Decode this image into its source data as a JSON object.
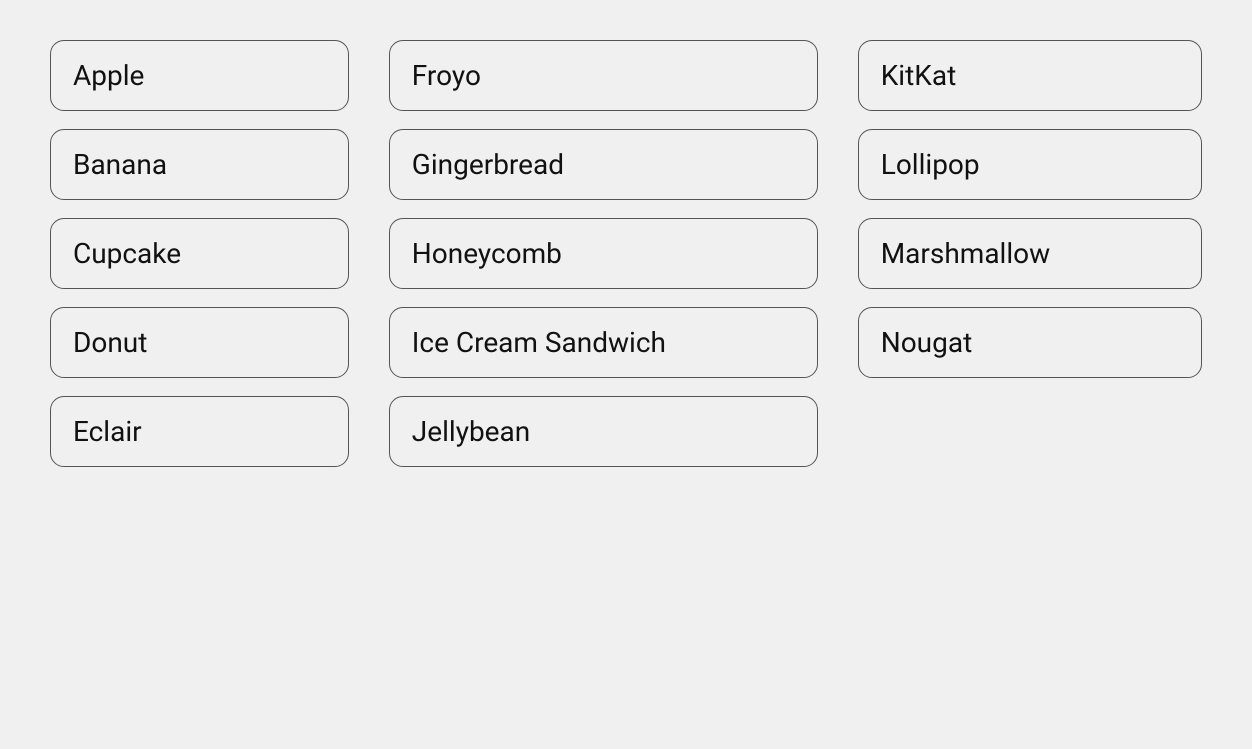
{
  "columns": [
    {
      "id": "col1",
      "items": [
        "Apple",
        "Banana",
        "Cupcake",
        "Donut",
        "Eclair"
      ]
    },
    {
      "id": "col2",
      "items": [
        "Froyo",
        "Gingerbread",
        "Honeycomb",
        "Ice Cream Sandwich",
        "Jellybean"
      ]
    },
    {
      "id": "col3",
      "items": [
        "KitKat",
        "Lollipop",
        "Marshmallow",
        "Nougat"
      ]
    }
  ]
}
